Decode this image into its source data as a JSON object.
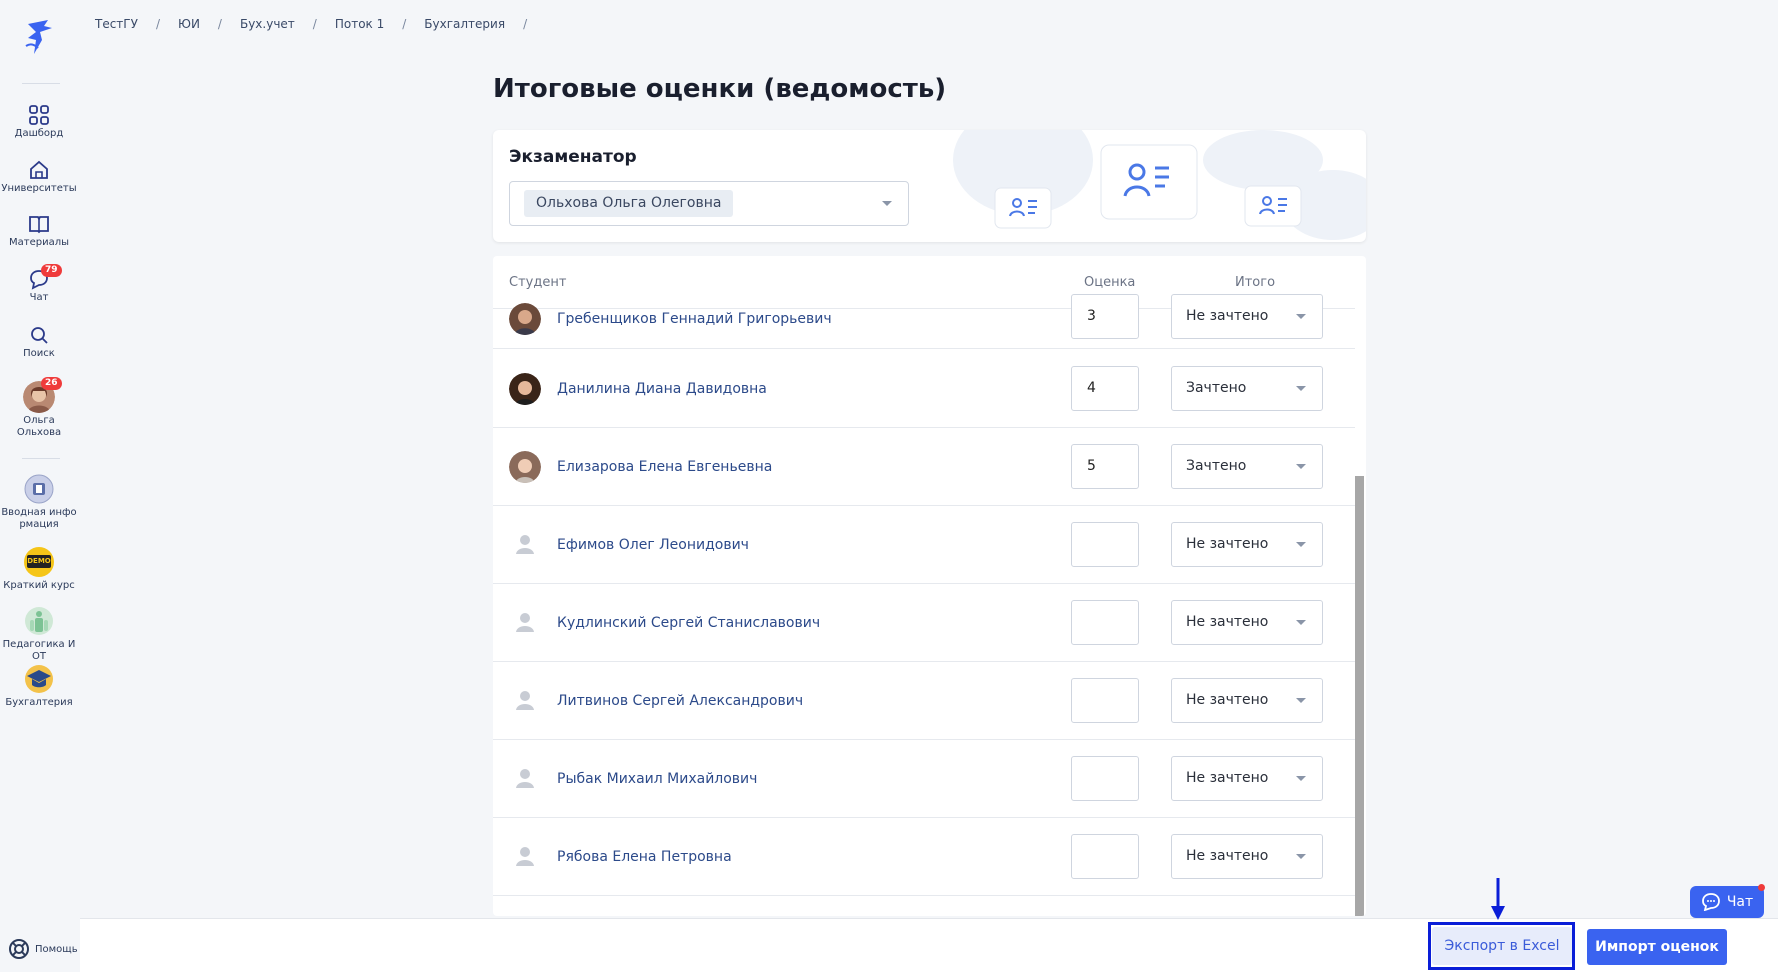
{
  "breadcrumb": [
    "ТестГУ",
    "ЮИ",
    "Бух.учет",
    "Поток 1",
    "Бухгалтерия"
  ],
  "breadcrumb_separator": "/",
  "page_title": "Итоговые оценки (ведомость)",
  "sidebar": {
    "nav": [
      {
        "label": "Дашборд",
        "icon": "dashboard-grid-icon"
      },
      {
        "label": "Университеты",
        "icon": "university-home-icon"
      },
      {
        "label": "Материалы",
        "icon": "book-icon"
      },
      {
        "label": "Чат",
        "icon": "chat-bubble-icon",
        "badge": "79"
      },
      {
        "label": "Поиск",
        "icon": "search-icon"
      }
    ],
    "user": {
      "label_line1": "Ольга",
      "label_line2": "Ольхова",
      "badge": "26"
    },
    "courses": [
      {
        "label_line1": "Вводная инфо",
        "label_line2": "рмация"
      },
      {
        "label_line1": "Краткий курс",
        "label_line2": ""
      },
      {
        "label_line1": "Педагогика И",
        "label_line2": "ОТ"
      },
      {
        "label_line1": "Бухгалтерия",
        "label_line2": ""
      }
    ],
    "course_demo_text": "DEMO",
    "help_label": "Помощь"
  },
  "examiner": {
    "label": "Экзаменатор",
    "selected": "Ольхова Ольга Олеговна"
  },
  "table": {
    "headers": {
      "student": "Студент",
      "grade": "Оценка",
      "result": "Итого"
    },
    "rows": [
      {
        "name": "Гребенщиков Геннадий Григорьевич",
        "grade": "3",
        "result": "Не зачтено",
        "avatar": "photo-male"
      },
      {
        "name": "Данилина Диана Давидовна",
        "grade": "4",
        "result": "Зачтено",
        "avatar": "photo-female-dark"
      },
      {
        "name": "Елизарова Елена Евгеньевна",
        "grade": "5",
        "result": "Зачтено",
        "avatar": "photo-female-light"
      },
      {
        "name": "Ефимов Олег Леонидович",
        "grade": "",
        "result": "Не зачтено",
        "avatar": "placeholder"
      },
      {
        "name": "Кудлинский Сергей Станиславович",
        "grade": "",
        "result": "Не зачтено",
        "avatar": "placeholder"
      },
      {
        "name": "Литвинов Сергей Александрович",
        "grade": "",
        "result": "Не зачтено",
        "avatar": "placeholder"
      },
      {
        "name": "Рыбак Михаил Михайлович",
        "grade": "",
        "result": "Не зачтено",
        "avatar": "placeholder"
      },
      {
        "name": "Рябова Елена Петровна",
        "grade": "",
        "result": "Не зачтено",
        "avatar": "placeholder"
      }
    ]
  },
  "actions": {
    "export_label": "Экспорт в Excel",
    "import_label": "Импорт оценок"
  },
  "chat_widget": {
    "label": "Чат"
  },
  "colors": {
    "primary": "#3a63f0",
    "highlight": "#0a1ed8",
    "badge": "#ef3b3b",
    "link": "#2c4a8a"
  }
}
